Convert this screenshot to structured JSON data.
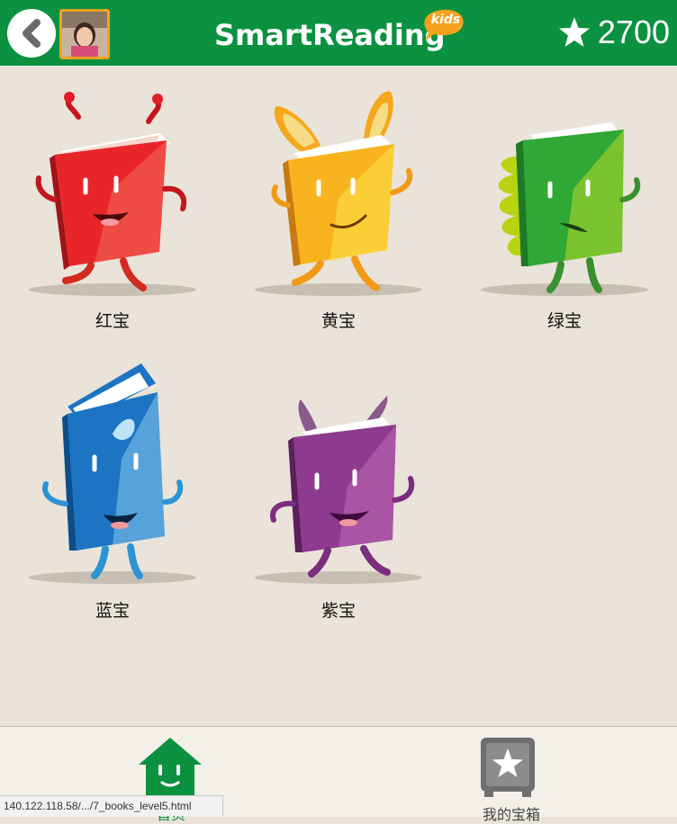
{
  "header": {
    "logo_text": "SmartReading",
    "logo_badge": "kids",
    "score": "2700",
    "colors": {
      "bar": "#0b9140",
      "avatar_border": "#f4a21f"
    }
  },
  "characters": [
    {
      "label": "红宝",
      "color": "#e8262a"
    },
    {
      "label": "黄宝",
      "color": "#f6a81c"
    },
    {
      "label": "绿宝",
      "color": "#2fa836"
    },
    {
      "label": "蓝宝",
      "color": "#1c74c2"
    },
    {
      "label": "紫宝",
      "color": "#8e3a8e"
    }
  ],
  "bottom_nav": {
    "home_label": "首页",
    "treasure_label": "我的宝箱"
  },
  "status_url": "140.122.118.58/.../7_books_level5.html"
}
